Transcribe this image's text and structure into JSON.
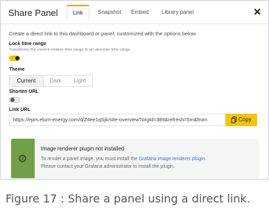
{
  "panel": {
    "title": "Share Panel",
    "tabs": [
      {
        "label": "Link"
      },
      {
        "label": "Snapshot"
      },
      {
        "label": "Embed"
      },
      {
        "label": "Library panel"
      }
    ],
    "close_icon": "close-icon"
  },
  "content": {
    "description": "Create a direct link to this dashboard or panel, customized with the options below.",
    "lock_time": {
      "label": "Lock time range",
      "sublabel": "Transforms the current relative time range to an absolute time range",
      "enabled": true
    },
    "theme": {
      "label": "Theme",
      "options": [
        "Current",
        "Dark",
        "Light"
      ],
      "selected": "Current"
    },
    "shorten_url": {
      "label": "Shorten URL",
      "enabled": false
    },
    "link_url": {
      "label": "Link URL",
      "value": "https://epm.elum-energy.com/d/Z4ee1qSjk/site-overview?orgId=389&refresh=5m&from",
      "copy_label": "Copy"
    }
  },
  "alert": {
    "title": "Image renderer plugin not installed",
    "line1_prefix": "To render a panel image, you must install the ",
    "line1_link": "Grafana image renderer plugin",
    "line1_suffix": ".",
    "line2": "Please contact your Grafana administrator to install the plugin.",
    "icon": "info-icon",
    "accent_color": "#72a04a"
  },
  "caption": "Figure 17 : Share a panel using a direct link.",
  "colors": {
    "tab_accent": "#f59a1d",
    "switch_on": "#f3c10a",
    "copy_button": "#f5c40f"
  }
}
